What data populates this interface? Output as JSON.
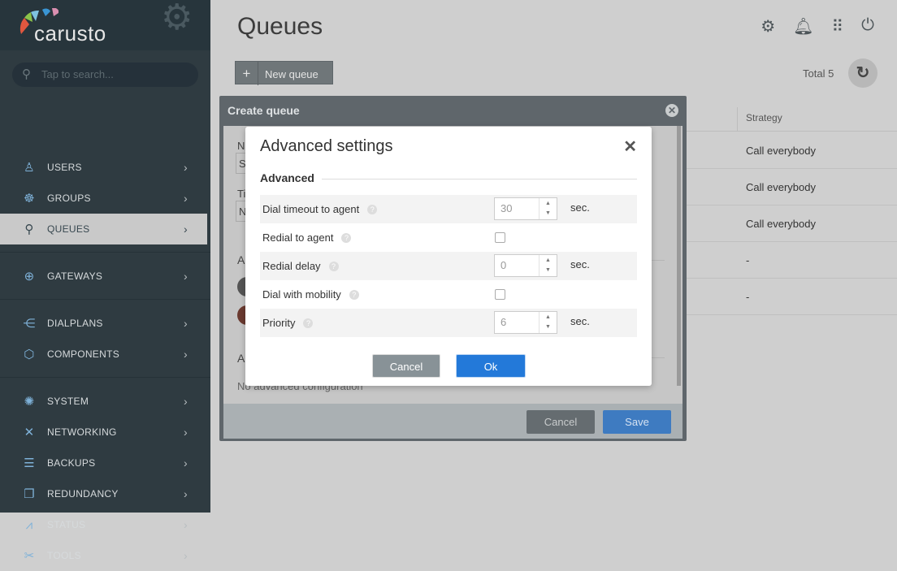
{
  "brand": {
    "name": "carusto"
  },
  "sidebar": {
    "search_placeholder": "Tap to search...",
    "items": [
      {
        "label": "USERS",
        "icon": "user-icon"
      },
      {
        "label": "GROUPS",
        "icon": "groups-icon"
      },
      {
        "label": "QUEUES",
        "icon": "queues-icon",
        "active": true
      },
      {
        "label": "GATEWAYS",
        "icon": "globe-icon"
      },
      {
        "label": "DIALPLANS",
        "icon": "share-icon"
      },
      {
        "label": "COMPONENTS",
        "icon": "cube-icon"
      },
      {
        "label": "SYSTEM",
        "icon": "system-icon"
      },
      {
        "label": "NETWORKING",
        "icon": "network-icon"
      },
      {
        "label": "BACKUPS",
        "icon": "database-icon"
      },
      {
        "label": "REDUNDANCY",
        "icon": "redundancy-icon"
      },
      {
        "label": "STATUS",
        "icon": "chart-icon"
      },
      {
        "label": "TOOLS",
        "icon": "tools-icon"
      }
    ]
  },
  "header": {
    "title": "Queues",
    "icons": [
      "settings-icon",
      "bell-icon",
      "apps-grid-icon",
      "power-icon"
    ]
  },
  "toolbar": {
    "new_queue": "New queue",
    "total": "Total 5"
  },
  "table": {
    "column": "Strategy",
    "rows": [
      "Call everybody",
      "Call everybody",
      "Call everybody",
      "-",
      "-"
    ]
  },
  "create_queue": {
    "title": "Create queue",
    "partial": [
      "N",
      "S",
      "Ti",
      "N",
      "A",
      "A"
    ],
    "no_config": "No advanced configuration",
    "cancel": "Cancel",
    "save": "Save"
  },
  "advanced": {
    "title": "Advanced settings",
    "section": "Advanced",
    "rows": [
      {
        "label": "Dial timeout to agent",
        "type": "number",
        "value": "30",
        "unit": "sec."
      },
      {
        "label": "Redial to agent",
        "type": "checkbox",
        "checked": false
      },
      {
        "label": "Redial delay",
        "type": "number",
        "value": "0",
        "unit": "sec."
      },
      {
        "label": "Dial with mobility",
        "type": "checkbox",
        "checked": false
      },
      {
        "label": "Priority",
        "type": "number",
        "value": "6",
        "unit": "sec."
      }
    ],
    "cancel": "Cancel",
    "ok": "Ok"
  },
  "colors": {
    "accent": "#2379d9",
    "sidebar": "#2f3b41"
  }
}
